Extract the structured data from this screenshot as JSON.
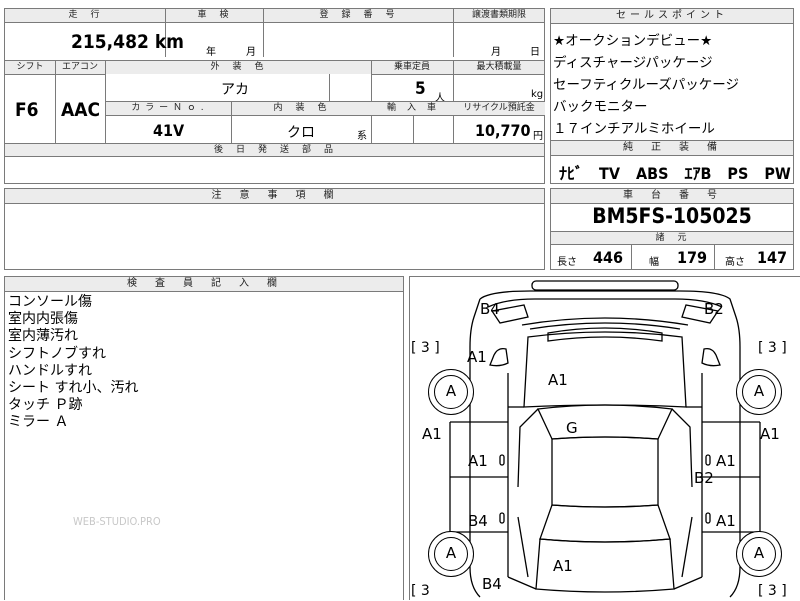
{
  "top_table": {
    "mileage_label": "走　行",
    "mileage_value": "215,482",
    "mileage_unit": "km",
    "inspection_label": "車　検",
    "inspection_year_unit": "年",
    "inspection_month_unit": "月",
    "registration_label": "登　録　番　号",
    "transfer_label": "譲渡書類期限",
    "transfer_month_unit": "月",
    "transfer_day_unit": "日",
    "shift_label": "シフト",
    "shift_value": "F6",
    "aircon_label": "エアコン",
    "aircon_value": "AAC",
    "exterior_color_label": "外　装　色",
    "exterior_color_value": "アカ",
    "capacity_label": "乗車定員",
    "capacity_value": "5",
    "capacity_unit": "人",
    "max_load_label": "最大積載量",
    "max_load_unit": "kg",
    "color_no_label": "カ ラ ー Ｎ ｏ .",
    "color_no_value": "41V",
    "interior_color_label": "内　装　色",
    "interior_color_value": "クロ",
    "interior_color_suffix": "系",
    "import_label": "輸　入　車",
    "recycle_label": "リサイクル預託金",
    "recycle_value": "10,770",
    "recycle_unit": "円",
    "later_parts_label": "後　日　発　送　部　品"
  },
  "sales_points": {
    "header": "セールスポイント",
    "items": [
      "★オークションデビュー★",
      "ディスチャージパッケージ",
      "セーフティクルーズパッケージ",
      "バックモニター",
      "１７インチアルミホイール"
    ]
  },
  "equipment": {
    "header": "純　正　装　備",
    "value": "ﾅﾋﾞ　TV　ABS　ｴｱB　PS　PW"
  },
  "notes": {
    "header": "注　意　事　項　欄"
  },
  "chassis": {
    "header": "車　台　番　号",
    "value": "BM5FS-105025"
  },
  "specs": {
    "header": "諸　元",
    "length_label": "長さ",
    "length_value": "446",
    "width_label": "幅",
    "width_value": "179",
    "height_label": "高さ",
    "height_value": "147"
  },
  "inspector": {
    "header": "検　査　員　記　入　欄",
    "lines": [
      "コンソール傷",
      "室内内張傷",
      "室内薄汚れ",
      "シフトノブすれ",
      "ハンドルすれ",
      "シート すれ小、汚れ",
      "タッチ Ｐ跡",
      "ミラー Ａ"
    ],
    "watermark": "WEB-STUDIO.PRO"
  },
  "diagram": {
    "bracket_tl": "[ 3 ]",
    "bracket_tr": "[ 3 ]",
    "bracket_bl": "[ 3",
    "bracket_br": "[ 3 ]",
    "wheel_fl": "A",
    "wheel_fr": "A",
    "wheel_rl": "A",
    "wheel_rr": "A",
    "marks": {
      "front_left_corner": "B4",
      "front_right_corner": "B2",
      "front_left_fender": "A1",
      "hood": "A1",
      "roof": "G",
      "left_side": "A1",
      "right_side": "A1",
      "left_front_door": "A1",
      "right_front_door": "A1",
      "right_pillar": "B2",
      "left_rear_door": "B4",
      "right_rear_door": "A1",
      "trunk": "A1",
      "rear_left": "B4"
    }
  }
}
